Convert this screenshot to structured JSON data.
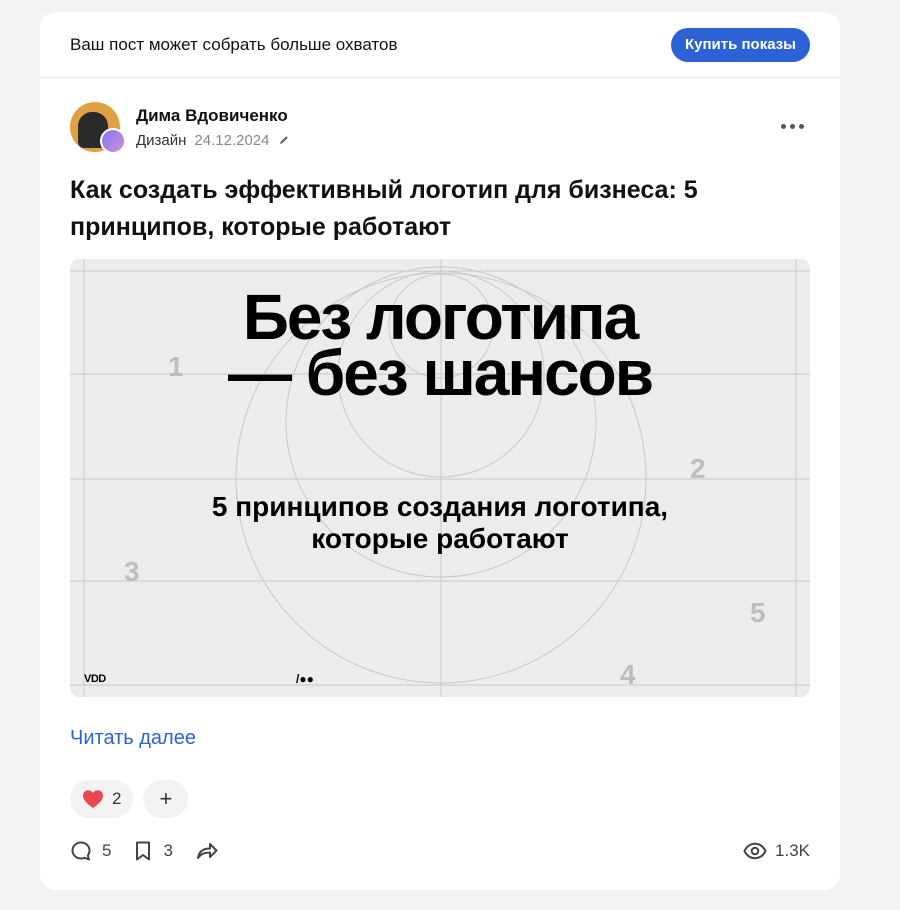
{
  "promo": {
    "text": "Ваш пост может собрать больше охватов",
    "button_label": "Купить показы"
  },
  "author": {
    "name": "Дима Вдовиченко",
    "category": "Дизайн",
    "date": "24.12.2024"
  },
  "post": {
    "title": "Как создать эффективный логотип для бизнеса: 5 принципов, которые работают",
    "cover": {
      "headline_line1": "Без логотипа",
      "headline_line2": "— без шансов",
      "subtitle_line1": "5 принципов создания логотипа,",
      "subtitle_line2": "которые работают",
      "numbers": [
        "1",
        "2",
        "3",
        "4",
        "5"
      ],
      "brand": "VDD",
      "logo": "/●●"
    },
    "read_more": "Читать далее"
  },
  "reactions": {
    "likes": "2",
    "add": "+"
  },
  "stats": {
    "comments": "5",
    "bookmarks": "3",
    "views": "1.3K"
  },
  "colors": {
    "accent": "#2d62d6",
    "heart": "#e8484f",
    "background": "#f2f2f2"
  },
  "icons": [
    "pencil-icon",
    "more-icon",
    "heart-icon",
    "plus-icon",
    "comment-icon",
    "bookmark-icon",
    "share-icon",
    "eye-icon"
  ]
}
